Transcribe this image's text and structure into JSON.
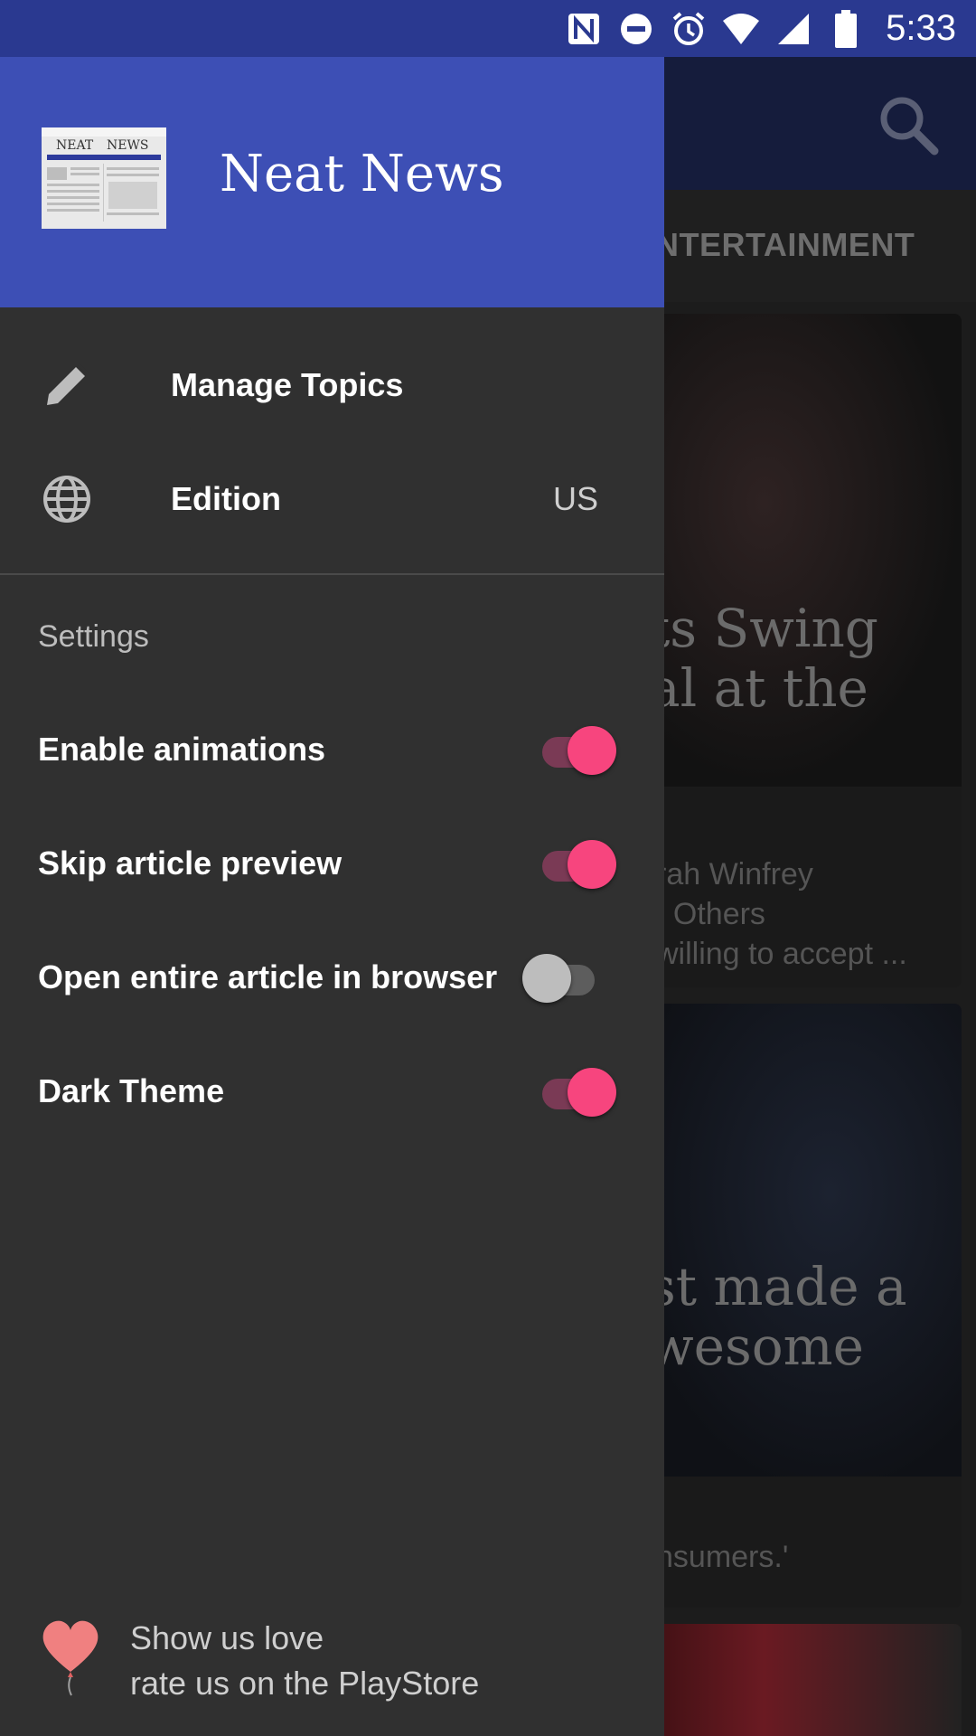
{
  "status_bar": {
    "time": "5:33",
    "icons": [
      "nfc-icon",
      "do-not-disturb-icon",
      "alarm-icon",
      "wifi-icon",
      "signal-icon",
      "battery-icon"
    ]
  },
  "background": {
    "tab_label": "NTERTAINMENT",
    "card1": {
      "headline_line1": "ts Swing",
      "headline_line2": "al at the",
      "snippet_line1": "rah Winfrey",
      "snippet_line2": ". Others",
      "snippet_line3": "willing to accept ..."
    },
    "card2": {
      "headline_line1": "st made a",
      "headline_line2": "wesome",
      "snippet_line1": "nsumers.'"
    }
  },
  "drawer": {
    "app_name": "Neat News",
    "logo_text_left": "NEAT",
    "logo_text_right": "NEWS",
    "nav": [
      {
        "label": "Manage Topics",
        "icon": "pencil-icon"
      },
      {
        "label": "Edition",
        "value": "US",
        "icon": "globe-icon"
      }
    ],
    "settings_title": "Settings",
    "settings": [
      {
        "label": "Enable animations",
        "on": true
      },
      {
        "label": "Skip article preview",
        "on": true
      },
      {
        "label": "Open entire article in browser",
        "on": false
      },
      {
        "label": "Dark Theme",
        "on": true
      }
    ],
    "love_line1": "Show us love",
    "love_line2": "rate us on the PlayStore"
  },
  "colors": {
    "accent": "#f7457e",
    "header": "#3d4fb5",
    "drawer_bg": "#303030"
  }
}
